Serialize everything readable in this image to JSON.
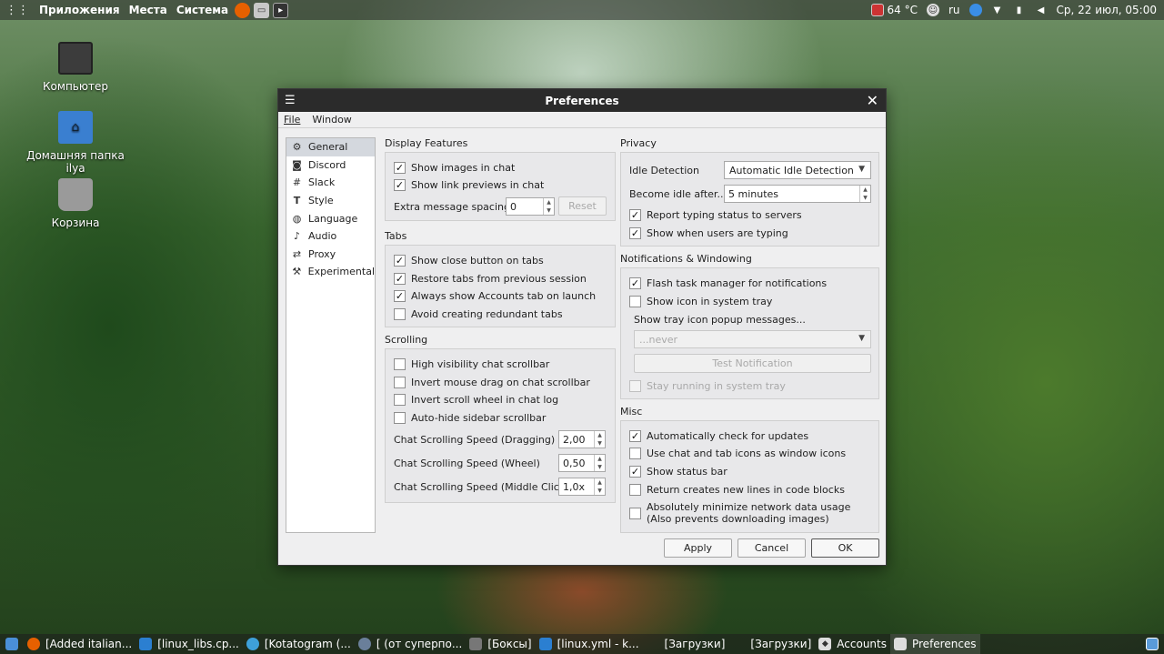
{
  "top_panel": {
    "menus": [
      "Приложения",
      "Места",
      "Система"
    ],
    "temperature": "64 °C",
    "keyboard_layout": "ru",
    "datetime": "Ср, 22 июл, 05:00"
  },
  "desktop_icons": [
    {
      "label": "Компьютер",
      "icon": "computer-icon"
    },
    {
      "label": "Домашняя папка ilya",
      "icon": "home-folder-icon"
    },
    {
      "label": "Корзина",
      "icon": "trash-icon"
    }
  ],
  "window": {
    "title": "Preferences",
    "menu": [
      "File",
      "Window"
    ],
    "sidebar": [
      {
        "label": "General",
        "icon": "gear-icon"
      },
      {
        "label": "Discord",
        "icon": "discord-icon"
      },
      {
        "label": "Slack",
        "icon": "slack-icon"
      },
      {
        "label": "Style",
        "icon": "style-icon"
      },
      {
        "label": "Language",
        "icon": "globe-icon"
      },
      {
        "label": "Audio",
        "icon": "microphone-icon"
      },
      {
        "label": "Proxy",
        "icon": "proxy-icon"
      },
      {
        "label": "Experimental",
        "icon": "wrench-icon"
      }
    ],
    "display_features": {
      "title": "Display Features",
      "show_images": {
        "label": "Show images in chat",
        "checked": true
      },
      "show_link_previews": {
        "label": "Show link previews in chat",
        "checked": true
      },
      "extra_spacing_label": "Extra message spacing",
      "extra_spacing_value": "0",
      "reset_label": "Reset"
    },
    "tabs": {
      "title": "Tabs",
      "items": [
        {
          "label": "Show close button on tabs",
          "checked": true
        },
        {
          "label": "Restore tabs from previous session",
          "checked": true
        },
        {
          "label": "Always show Accounts tab on launch",
          "checked": true
        },
        {
          "label": "Avoid creating redundant tabs",
          "checked": false
        }
      ]
    },
    "scrolling": {
      "title": "Scrolling",
      "items": [
        {
          "label": "High visibility chat scrollbar",
          "checked": false
        },
        {
          "label": "Invert mouse drag on chat scrollbar",
          "checked": false
        },
        {
          "label": "Invert scroll wheel in chat log",
          "checked": false
        },
        {
          "label": "Auto-hide sidebar scrollbar",
          "checked": false
        }
      ],
      "speeds": [
        {
          "label": "Chat Scrolling Speed (Dragging)",
          "value": "2,00"
        },
        {
          "label": "Chat Scrolling Speed (Wheel)",
          "value": "0,50"
        },
        {
          "label": "Chat Scrolling Speed (Middle Click)",
          "value": "1,0x"
        }
      ]
    },
    "privacy": {
      "title": "Privacy",
      "idle_detection_label": "Idle Detection",
      "idle_detection_value": "Automatic Idle Detection",
      "become_idle_label": "Become idle after...",
      "become_idle_value": "5 minutes",
      "report_typing": {
        "label": "Report typing status to servers",
        "checked": true
      },
      "show_typing": {
        "label": "Show when users are typing",
        "checked": true
      }
    },
    "notifications": {
      "title": "Notifications & Windowing",
      "flash_task": {
        "label": "Flash task manager for notifications",
        "checked": true
      },
      "tray_icon": {
        "label": "Show icon in system tray",
        "checked": false
      },
      "popup_label": "Show tray icon popup messages...",
      "popup_value": "...never",
      "test_label": "Test Notification",
      "stay_running": {
        "label": "Stay running in system tray",
        "checked": false
      }
    },
    "misc": {
      "title": "Misc",
      "items": [
        {
          "label": "Automatically check for updates",
          "checked": true
        },
        {
          "label": "Use chat and tab icons as window icons",
          "checked": false
        },
        {
          "label": "Show status bar",
          "checked": true
        },
        {
          "label": "Return creates new lines in code blocks",
          "checked": false
        }
      ],
      "minimize": {
        "label_1": "Absolutely minimize network data usage",
        "label_2": "(Also prevents downloading images)",
        "checked": false
      }
    },
    "buttons": {
      "apply": "Apply",
      "cancel": "Cancel",
      "ok": "OK"
    }
  },
  "taskbar": [
    {
      "label": "[Added italian...",
      "icon": "firefox-icon"
    },
    {
      "label": "[linux_libs.cp...",
      "icon": "vscode-icon"
    },
    {
      "label": "[Kotatogram (...",
      "icon": "telegram-icon"
    },
    {
      "label": "[ (от суперпо...",
      "icon": "chat-icon"
    },
    {
      "label": "[Боксы]",
      "icon": "boxes-icon"
    },
    {
      "label": "[linux.yml - k...",
      "icon": "vscode-icon"
    },
    {
      "label": "[Загрузки]",
      "icon": "folder-icon"
    },
    {
      "label": "[Загрузки]",
      "icon": "folder-icon"
    },
    {
      "label": "Accounts",
      "icon": "accounts-icon"
    },
    {
      "label": "Preferences",
      "icon": "preferences-icon"
    }
  ]
}
